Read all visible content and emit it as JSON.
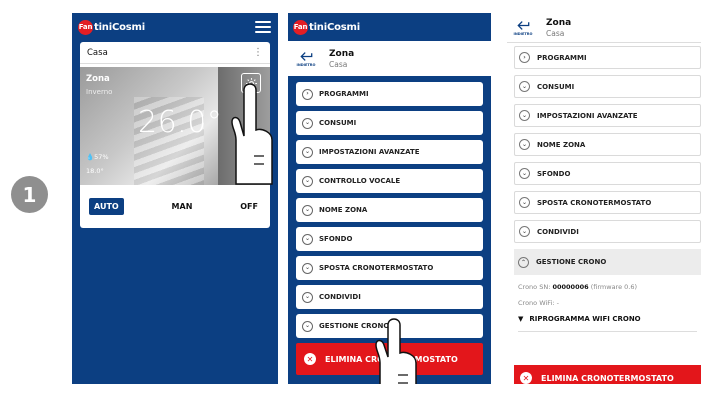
{
  "step": {
    "number": "1"
  },
  "brand": {
    "logo_badge": "Fan",
    "logo_text": "tiniCosmi"
  },
  "screen1": {
    "card_title": "Casa",
    "card_menu": "⋮",
    "zone_name": "Zona",
    "season": "Inverno",
    "temperature": "26.0°",
    "humidity": "57%",
    "setpoint": "18.0°",
    "modes": {
      "auto": "AUTO",
      "man": "MAN",
      "off": "OFF"
    }
  },
  "screen2": {
    "back_label": "INDIETRO",
    "title": "Zona",
    "subtitle": "Casa",
    "menu": [
      {
        "label": "PROGRAMMI",
        "icon": "chevron-right-icon"
      },
      {
        "label": "CONSUMI",
        "icon": "chevron-down-icon"
      },
      {
        "label": "IMPOSTAZIONI AVANZATE",
        "icon": "chevron-down-icon"
      },
      {
        "label": "CONTROLLO VOCALE",
        "icon": "chevron-down-icon"
      },
      {
        "label": "NOME ZONA",
        "icon": "chevron-down-icon"
      },
      {
        "label": "SFONDO",
        "icon": "chevron-down-icon"
      },
      {
        "label": "SPOSTA CRONOTERMOSTATO",
        "icon": "chevron-down-icon"
      },
      {
        "label": "CONDIVIDI",
        "icon": "chevron-down-icon"
      },
      {
        "label": "GESTIONE CRONO",
        "icon": "chevron-down-icon"
      }
    ],
    "delete_label": "ELIMINA CRONOTERMOSTATO"
  },
  "screen3": {
    "back_label": "INDIETRO",
    "title": "Zona",
    "subtitle": "Casa",
    "menu": [
      {
        "label": "PROGRAMMI",
        "icon": "chevron-right-icon"
      },
      {
        "label": "CONSUMI",
        "icon": "chevron-down-icon"
      },
      {
        "label": "IMPOSTAZIONI AVANZATE",
        "icon": "chevron-down-icon"
      },
      {
        "label": "NOME ZONA",
        "icon": "chevron-down-icon"
      },
      {
        "label": "SFONDO",
        "icon": "chevron-down-icon"
      },
      {
        "label": "SPOSTA CRONOTERMOSTATO",
        "icon": "chevron-down-icon"
      },
      {
        "label": "CONDIVIDI",
        "icon": "chevron-down-icon"
      }
    ],
    "expanded": {
      "label": "GESTIONE CRONO",
      "icon": "chevron-up-icon",
      "crono_sn_label": "Crono SN:",
      "crono_sn_value": "00000006",
      "firmware": "(firmware 0.6)",
      "wifi_label": "Crono WiFi: -",
      "reprogram_label": "RIPROGRAMMA WIFI CRONO"
    },
    "delete_label": "ELIMINA CRONOTERMOSTATO"
  },
  "colors": {
    "brand_blue": "#0c3f82",
    "danger_red": "#e3161b",
    "logo_red": "#e31e24"
  }
}
